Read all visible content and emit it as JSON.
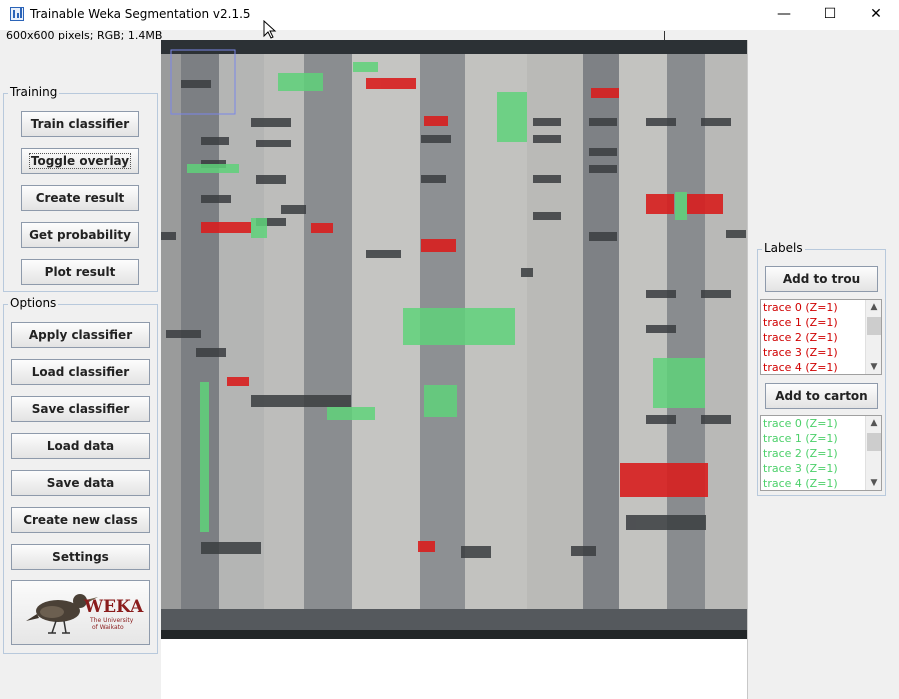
{
  "window": {
    "title": "Trainable Weka Segmentation v2.1.5",
    "subtitle": "600x600 pixels; RGB; 1.4MB",
    "minimize": "—",
    "maximize": "☐",
    "close": "✕"
  },
  "training": {
    "legend": "Training",
    "buttons": [
      "Train classifier",
      "Toggle overlay",
      "Create result",
      "Get probability",
      "Plot result"
    ]
  },
  "options": {
    "legend": "Options",
    "buttons": [
      "Apply classifier",
      "Load classifier",
      "Save classifier",
      "Load data",
      "Save data",
      "Create new class",
      "Settings"
    ]
  },
  "logo": {
    "title": "WEKA",
    "line1": "The University",
    "line2": "of Waikato"
  },
  "labels": {
    "legend": "Labels",
    "class1": {
      "button": "Add to trou",
      "color": "#d00000",
      "traces": [
        "trace 0 (Z=1)",
        "trace 1 (Z=1)",
        "trace 2 (Z=1)",
        "trace 3 (Z=1)",
        "trace 4 (Z=1)"
      ]
    },
    "class2": {
      "button": "Add to carton",
      "color": "#4cd06a",
      "traces": [
        "trace 0 (Z=1)",
        "trace 1 (Z=1)",
        "trace 2 (Z=1)",
        "trace 3 (Z=1)",
        "trace 4 (Z=1)"
      ]
    }
  },
  "overlay_colors": {
    "trou": "#d81e1e",
    "carton": "#5fd27a"
  }
}
